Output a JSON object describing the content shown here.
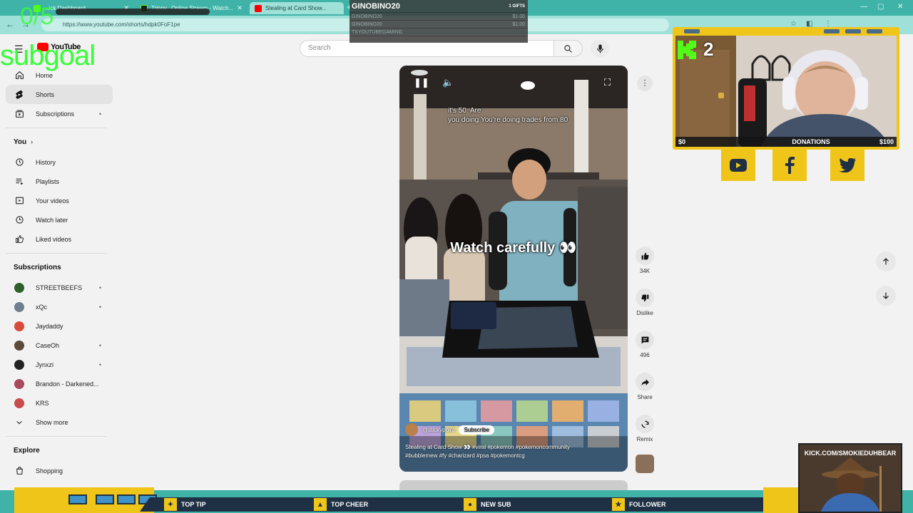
{
  "browser": {
    "tabs": [
      {
        "label": "...ick Dashboard"
      },
      {
        "label": "Trippy...Online Stream - Watch..."
      },
      {
        "label": "Stealing at Card Show..."
      }
    ],
    "url": "https://www.youtube.com/shorts/hdpk0FoF1pe"
  },
  "youtube": {
    "logo_text": "YouTube",
    "search_placeholder": "Search",
    "sidebar": {
      "main": [
        {
          "label": "Home",
          "icon": "home-icon"
        },
        {
          "label": "Shorts",
          "icon": "shorts-icon",
          "active": true
        },
        {
          "label": "Subscriptions",
          "icon": "subscriptions-icon",
          "dot": "•"
        }
      ],
      "you_heading": "You",
      "you_items": [
        {
          "label": "History",
          "icon": "history-icon"
        },
        {
          "label": "Playlists",
          "icon": "playlists-icon"
        },
        {
          "label": "Your videos",
          "icon": "your-videos-icon"
        },
        {
          "label": "Watch later",
          "icon": "watch-later-icon"
        },
        {
          "label": "Liked videos",
          "icon": "liked-videos-icon"
        }
      ],
      "subscriptions_heading": "Subscriptions",
      "subscriptions": [
        {
          "label": "STREETBEEFS",
          "color": "#2f5f2a",
          "dot": "•"
        },
        {
          "label": "xQc",
          "color": "#6f7f8f",
          "dot": "•"
        },
        {
          "label": "Jaydaddy",
          "color": "#d94a3a",
          "dot": ""
        },
        {
          "label": "CaseOh",
          "color": "#5a4a3a",
          "dot": "•"
        },
        {
          "label": "Jynxzi",
          "color": "#222222",
          "dot": "•"
        },
        {
          "label": "Brandon - Darkened...",
          "color": "#a84a5a",
          "dot": ""
        },
        {
          "label": "KRS",
          "color": "#c84a4a",
          "dot": ""
        }
      ],
      "show_more": "Show more",
      "explore_heading": "Explore",
      "explore_items": [
        {
          "label": "Shopping",
          "icon": "shopping-icon"
        }
      ]
    },
    "short": {
      "caption_top_1": "it's 50. Are",
      "caption_top_2": "you doing You're doing trades from 80",
      "caption_main": "Watch carefully 👀",
      "channel": "@stickypoint",
      "subscribe": "Subscribe",
      "desc_1": "Stealing at Card Show 👀 #viral #pokemon #pokemoncommunity",
      "desc_2": "#bubblemew #fy #charizard #psa #pokemontcg"
    },
    "actions": [
      {
        "label": "34K",
        "icon": "like-icon"
      },
      {
        "label": "Dislike",
        "icon": "dislike-icon"
      },
      {
        "label": "496",
        "icon": "comment-icon"
      },
      {
        "label": "Share",
        "icon": "share-icon"
      },
      {
        "label": "Remix",
        "icon": "remix-icon"
      }
    ]
  },
  "overlay": {
    "subgoal_count": "0/5",
    "subgoal_label": "subgoal",
    "chat": {
      "top_user": "GINOBINO20",
      "top_amount": "1 GIFTS",
      "rows": [
        {
          "user": "GINOBINO20",
          "amount": "$1.00"
        },
        {
          "user": "GINOBINO20",
          "amount": "$1.00"
        },
        {
          "user": "TXYOUTUBEGAMING",
          "amount": ""
        }
      ]
    },
    "kick_count": "2",
    "donations": {
      "min": "$0",
      "label": "DONATIONS",
      "max": "$100"
    },
    "social": [
      "youtube-icon",
      "facebook-icon",
      "twitter-icon"
    ],
    "alerts": [
      {
        "label": "TOP TIP",
        "icon": "tip-icon",
        "glyph": "✦"
      },
      {
        "label": "TOP CHEER",
        "icon": "cheer-icon",
        "glyph": "▲"
      },
      {
        "label": "NEW SUB",
        "icon": "sub-icon",
        "glyph": "●"
      },
      {
        "label": "FOLLOWER",
        "icon": "follower-icon",
        "glyph": "★"
      }
    ],
    "promo": "KICK.COM/SMOKIEDUHBEAR",
    "colors": {
      "accent_yellow": "#f0c51a",
      "accent_teal": "#3fb3a8",
      "goal_green": "#35ff35",
      "kick_green": "#53fc18"
    }
  }
}
